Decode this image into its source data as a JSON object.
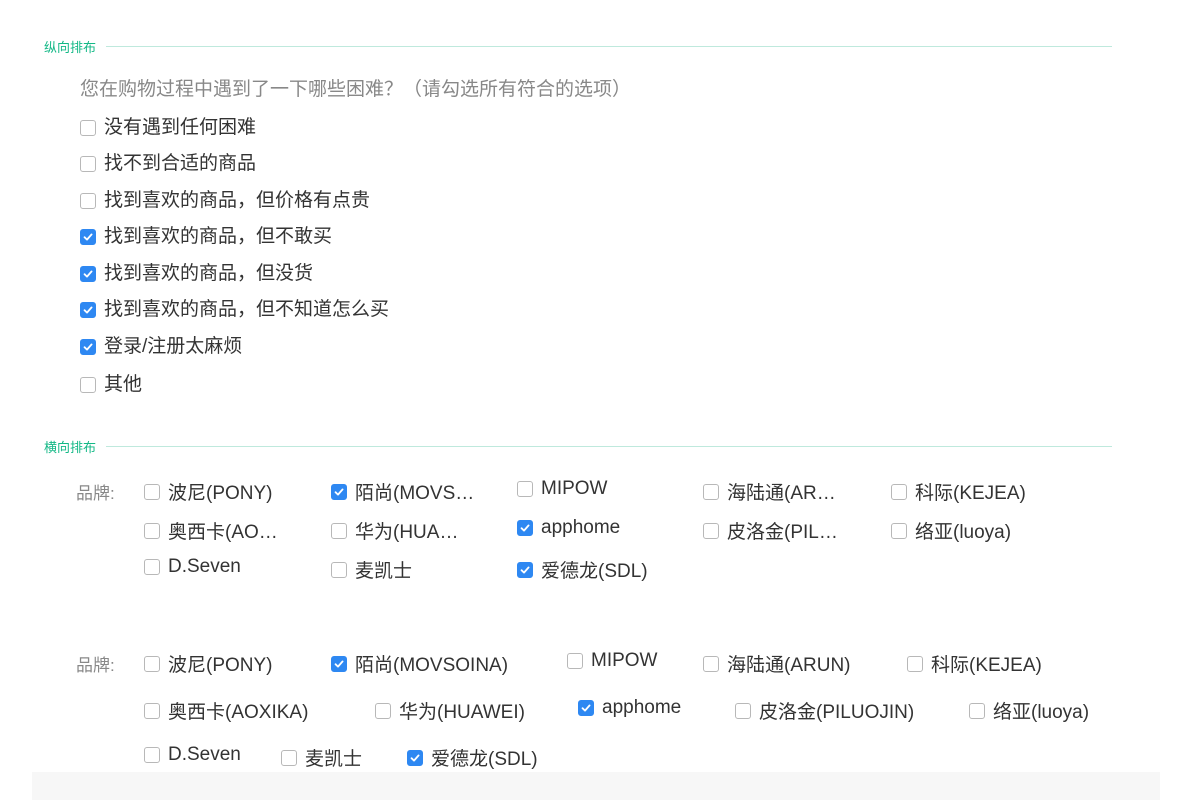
{
  "sections": {
    "vertical_title": "纵向排布",
    "horizontal_title": "横向排布"
  },
  "colors": {
    "accent": "#13b886",
    "checkbox_checked": "#2e88f2"
  },
  "survey": {
    "question": "您在购物过程中遇到了一下哪些困难？（请勾选所有符合的选项）",
    "options": [
      {
        "label": "没有遇到任何困难",
        "checked": false
      },
      {
        "label": "找不到合适的商品",
        "checked": false
      },
      {
        "label": "找到喜欢的商品，但价格有点贵",
        "checked": false
      },
      {
        "label": "找到喜欢的商品，但不敢买",
        "checked": true
      },
      {
        "label": "找到喜欢的商品，但没货",
        "checked": true
      },
      {
        "label": "找到喜欢的商品，但不知道怎么买",
        "checked": true
      },
      {
        "label": "登录/注册太麻烦",
        "checked": true
      },
      {
        "label": "其他",
        "checked": false
      }
    ]
  },
  "brand_grid": {
    "label": "品牌:",
    "options": [
      {
        "label": "波尼(PONY)",
        "checked": false
      },
      {
        "label": "陌尚(MOVS…",
        "checked": true
      },
      {
        "label": "MIPOW",
        "checked": false
      },
      {
        "label": "海陆通(AR…",
        "checked": false
      },
      {
        "label": "科际(KEJEA)",
        "checked": false
      },
      {
        "label": "奥西卡(AO…",
        "checked": false
      },
      {
        "label": "华为(HUA…",
        "checked": false
      },
      {
        "label": "apphome",
        "checked": true
      },
      {
        "label": "皮洛金(PIL…",
        "checked": false
      },
      {
        "label": "络亚(luoya)",
        "checked": false
      },
      {
        "label": "D.Seven",
        "checked": false
      },
      {
        "label": "麦凯士",
        "checked": false
      },
      {
        "label": "爱德龙(SDL)",
        "checked": true
      }
    ]
  },
  "brand_flow": {
    "label": "品牌:",
    "options": [
      {
        "label": "波尼(PONY)",
        "checked": false
      },
      {
        "label": "陌尚(MOVSOINA)",
        "checked": true
      },
      {
        "label": "MIPOW",
        "checked": false
      },
      {
        "label": "海陆通(ARUN)",
        "checked": false
      },
      {
        "label": "科际(KEJEA)",
        "checked": false
      },
      {
        "label": "奥西卡(AOXIKA)",
        "checked": false
      },
      {
        "label": "华为(HUAWEI)",
        "checked": false
      },
      {
        "label": "apphome",
        "checked": true
      },
      {
        "label": "皮洛金(PILUOJIN)",
        "checked": false
      },
      {
        "label": "络亚(luoya)",
        "checked": false
      },
      {
        "label": "D.Seven",
        "checked": false
      },
      {
        "label": "麦凯士",
        "checked": false
      },
      {
        "label": "爱德龙(SDL)",
        "checked": true
      }
    ]
  }
}
